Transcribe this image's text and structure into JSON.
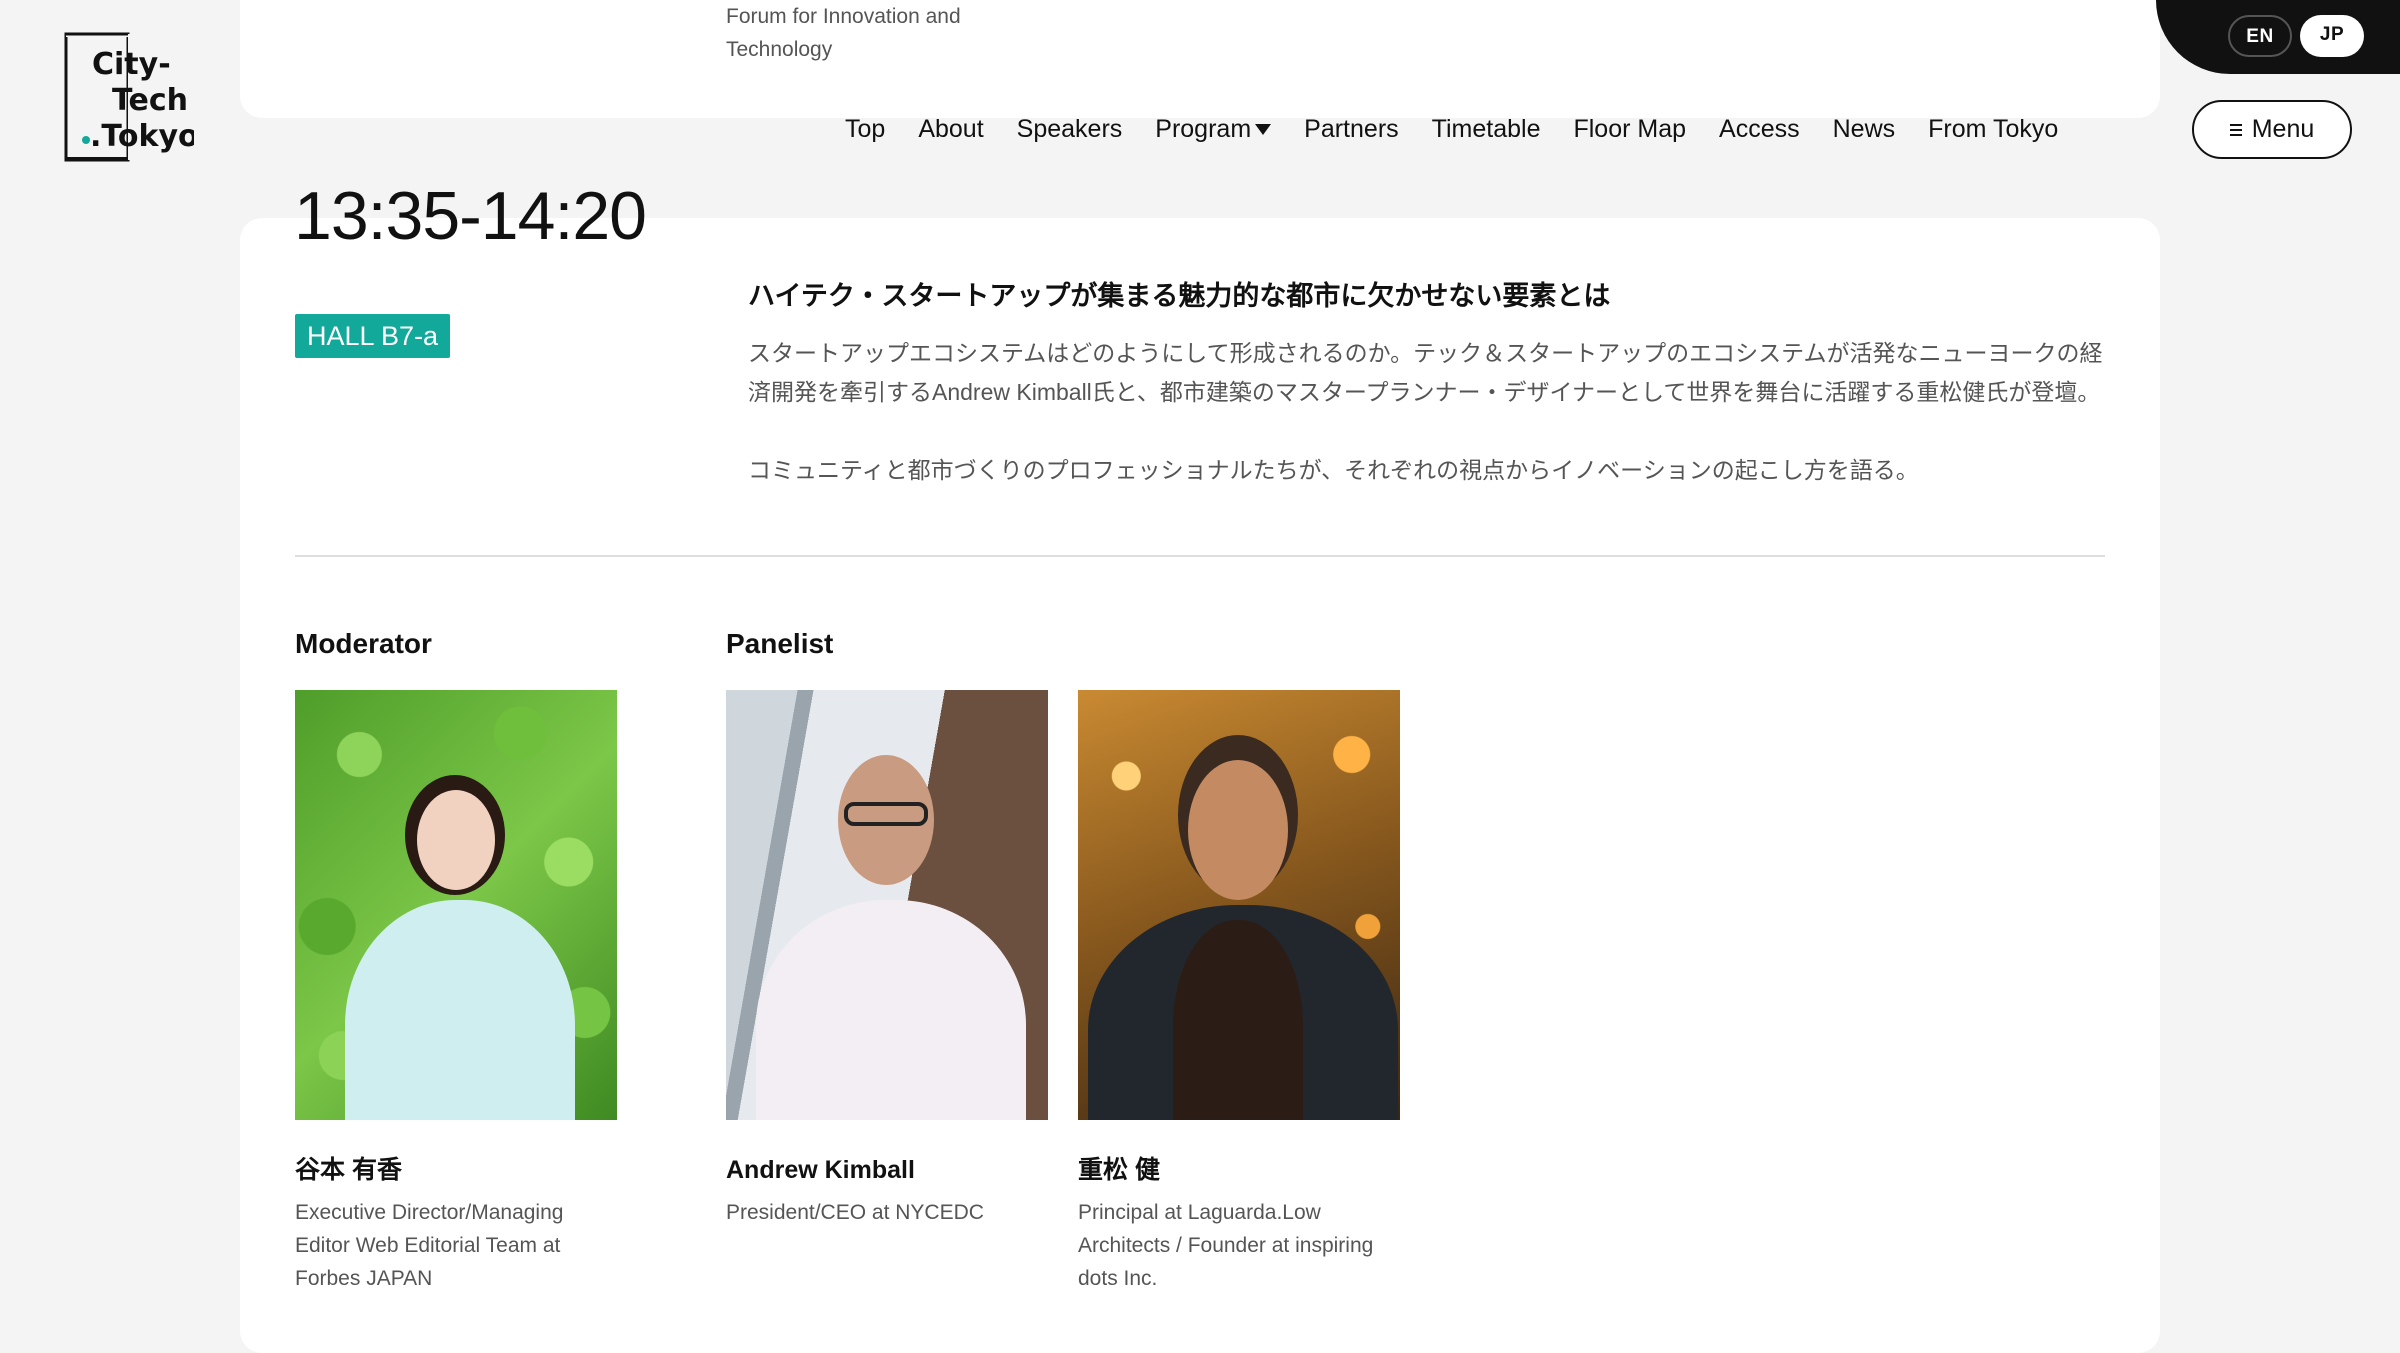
{
  "header": {
    "tagline": "Forum for Innovation and Technology",
    "logo_text": [
      "City-",
      "Tech",
      ".Tokyo"
    ],
    "languages": {
      "en": "EN",
      "jp": "JP",
      "active": "JP"
    },
    "nav": [
      {
        "label": "Top"
      },
      {
        "label": "About"
      },
      {
        "label": "Speakers"
      },
      {
        "label": "Program",
        "has_dropdown": true
      },
      {
        "label": "Partners"
      },
      {
        "label": "Timetable"
      },
      {
        "label": "Floor Map"
      },
      {
        "label": "Access"
      },
      {
        "label": "News"
      },
      {
        "label": "From Tokyo"
      }
    ],
    "menu_label": "Menu"
  },
  "session": {
    "time": "13:35-14:20",
    "hall": "HALL B7-a",
    "title": "ハイテク・スタートアップが集まる魅力的な都市に欠かせない要素とは",
    "description": [
      "スタートアップエコシステムはどのようにして形成されるのか。テック＆スタートアップのエコシステムが活発なニューヨークの経済開発を牽引するAndrew Kimball氏と、都市建築のマスタープランナー・デザイナーとして世界を舞台に活躍する重松健氏が登壇。",
      "コミュニティと都市づくりのプロフェッショナルたちが、それぞれの視点からイノベーションの起こし方を語る。"
    ]
  },
  "speakers": {
    "moderator_heading": "Moderator",
    "panelist_heading": "Panelist",
    "moderator": {
      "name": "谷本 有香",
      "affiliation": "Executive Director/Managing Editor Web Editorial Team at Forbes JAPAN"
    },
    "panelists": [
      {
        "name": "Andrew Kimball",
        "affiliation": "President/CEO at NYCEDC"
      },
      {
        "name": "重松 健",
        "affiliation": "Principal at Laguarda.Low Architects / Founder at inspiring dots Inc."
      }
    ]
  },
  "colors": {
    "hall_badge": "#12a99a",
    "background": "#f4f4f4",
    "accent_dot": "#12a99a"
  }
}
